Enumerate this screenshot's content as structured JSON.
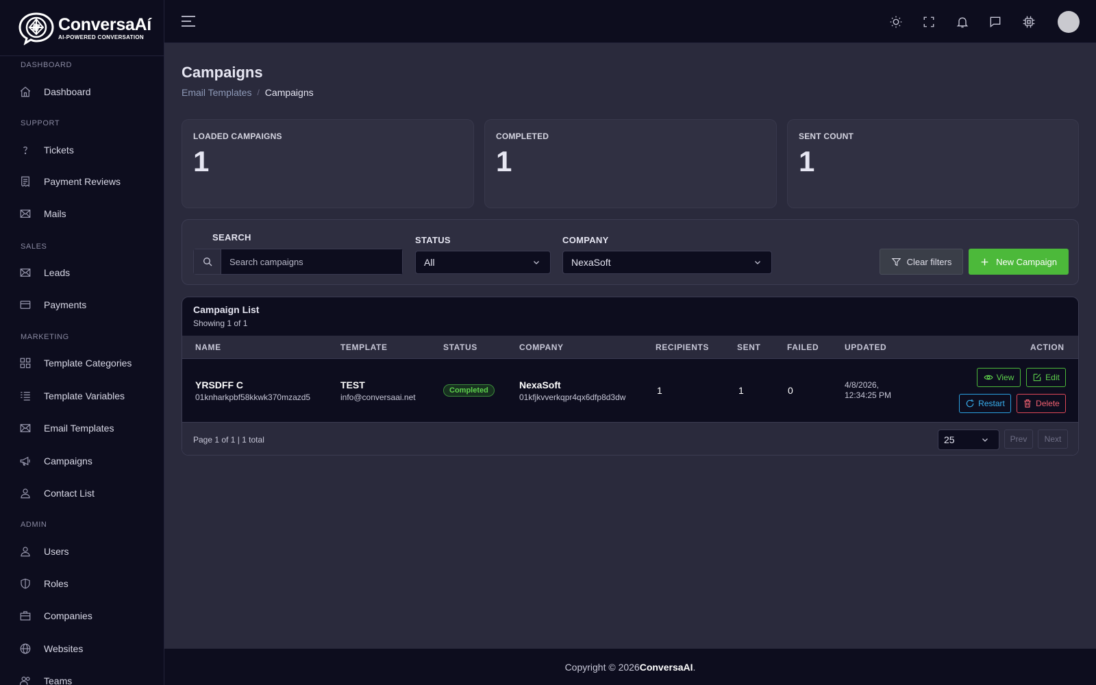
{
  "brand": {
    "name": "ConversaAí",
    "tagline": "AI-POWERED CONVERSATION"
  },
  "sidebar": {
    "sections": [
      {
        "label": "DASHBOARD",
        "items": [
          {
            "label": "Dashboard",
            "icon": "home-icon"
          }
        ]
      },
      {
        "label": "SUPPORT",
        "items": [
          {
            "label": "Tickets",
            "icon": "question-icon"
          },
          {
            "label": "Payment Reviews",
            "icon": "receipt-icon"
          },
          {
            "label": "Mails",
            "icon": "mail-icon"
          }
        ]
      },
      {
        "label": "SALES",
        "items": [
          {
            "label": "Leads",
            "icon": "mail-icon"
          },
          {
            "label": "Payments",
            "icon": "credit-card-icon"
          }
        ]
      },
      {
        "label": "MARKETING",
        "items": [
          {
            "label": "Template Categories",
            "icon": "grid-icon"
          },
          {
            "label": "Template Variables",
            "icon": "list-icon"
          },
          {
            "label": "Email Templates",
            "icon": "mail-icon"
          },
          {
            "label": "Campaigns",
            "icon": "megaphone-icon"
          },
          {
            "label": "Contact List",
            "icon": "user-icon"
          }
        ]
      },
      {
        "label": "ADMIN",
        "items": [
          {
            "label": "Users",
            "icon": "user-icon"
          },
          {
            "label": "Roles",
            "icon": "shield-icon"
          },
          {
            "label": "Companies",
            "icon": "briefcase-icon"
          },
          {
            "label": "Websites",
            "icon": "globe-icon"
          },
          {
            "label": "Teams",
            "icon": "team-icon"
          }
        ]
      }
    ]
  },
  "topbar": {
    "icons": [
      "hamburger-icon",
      "sun-icon",
      "fullscreen-icon",
      "bell-icon",
      "chat-icon",
      "chip-icon"
    ]
  },
  "page": {
    "title": "Campaigns",
    "breadcrumb": {
      "parent": "Email Templates",
      "separator": "/",
      "current": "Campaigns"
    }
  },
  "stats": [
    {
      "label": "LOADED CAMPAIGNS",
      "value": "1"
    },
    {
      "label": "COMPLETED",
      "value": "1"
    },
    {
      "label": "SENT COUNT",
      "value": "1"
    }
  ],
  "filters": {
    "search_label": "SEARCH",
    "search_placeholder": "Search campaigns",
    "search_value": "",
    "status_label": "STATUS",
    "status_value": "All",
    "company_label": "COMPANY",
    "company_value": "NexaSoft",
    "clear_label": "Clear filters",
    "new_label": "New Campaign"
  },
  "table": {
    "title": "Campaign List",
    "subtitle": "Showing 1 of 1",
    "columns": [
      "NAME",
      "TEMPLATE",
      "STATUS",
      "COMPANY",
      "RECIPIENTS",
      "SENT",
      "FAILED",
      "UPDATED",
      "ACTION"
    ],
    "rows": [
      {
        "name": "YRSDFF C",
        "name_id": "01knharkpbf58kkwk370mzazd5",
        "template": "TEST",
        "template_email": "info@conversaai.net",
        "status": "Completed",
        "company": "NexaSoft",
        "company_id": "01kfjkvverkqpr4qx6dfp8d3dw",
        "recipients": "1",
        "sent": "1",
        "failed": "0",
        "updated_date": "4/8/2026,",
        "updated_time": "12:34:25 PM",
        "actions": {
          "view": "View",
          "edit": "Edit",
          "restart": "Restart",
          "delete": "Delete"
        }
      }
    ],
    "pagination": {
      "info": "Page 1 of 1 | 1 total",
      "page_size": "25",
      "prev": "Prev",
      "next": "Next"
    }
  },
  "footer": {
    "prefix": "Copyright © 2026 ",
    "brand": "ConversaAI",
    "suffix": "."
  },
  "colors": {
    "accent_green": "#4cb93a",
    "restart_blue": "#2aa0e0",
    "delete_red": "#e04858",
    "sidebar_bg": "#0d0d1e",
    "main_bg": "#2a2a3c"
  }
}
